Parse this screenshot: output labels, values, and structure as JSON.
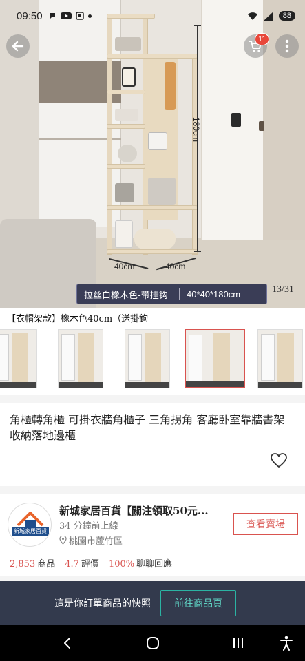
{
  "status_bar": {
    "time": "09:50",
    "battery": "88"
  },
  "header": {
    "cart_count": "11"
  },
  "hero": {
    "dimension_height": "180cm",
    "dimension_width_left": "40cm",
    "dimension_width_right": "40cm",
    "variant_name": "拉丝白橡木色-带挂钩",
    "variant_size": "40*40*180cm",
    "page_counter": "13/31"
  },
  "variants": {
    "label": "【衣帽架款】橡木色40cm（送掛鉤",
    "thumbnails": [
      {
        "selected": false
      },
      {
        "selected": false
      },
      {
        "selected": false
      },
      {
        "selected": true
      },
      {
        "selected": false
      }
    ]
  },
  "product": {
    "title": "角櫃轉角櫃 可掛衣牆角櫃子 三角拐角 客廳卧室靠牆書架 收納落地邊櫃"
  },
  "shop": {
    "logo_text": "新城家居百貨",
    "name": "新城家居百貨【關注領取50元...",
    "online": "34 分鐘前上線",
    "location": "桃園市蘆竹區",
    "view_button": "查看賣場",
    "products_count": "2,853",
    "products_label": "商品",
    "rating": "4.7",
    "rating_label": "評價",
    "response_rate": "100%",
    "response_label": "聊聊回應"
  },
  "snapshot_bar": {
    "text": "這是你訂單商品的快照",
    "goto_button": "前往商品頁"
  },
  "colors": {
    "accent_red": "#d9534f",
    "snapshot_bg": "#333a4d",
    "teal": "#2bb3a3"
  }
}
